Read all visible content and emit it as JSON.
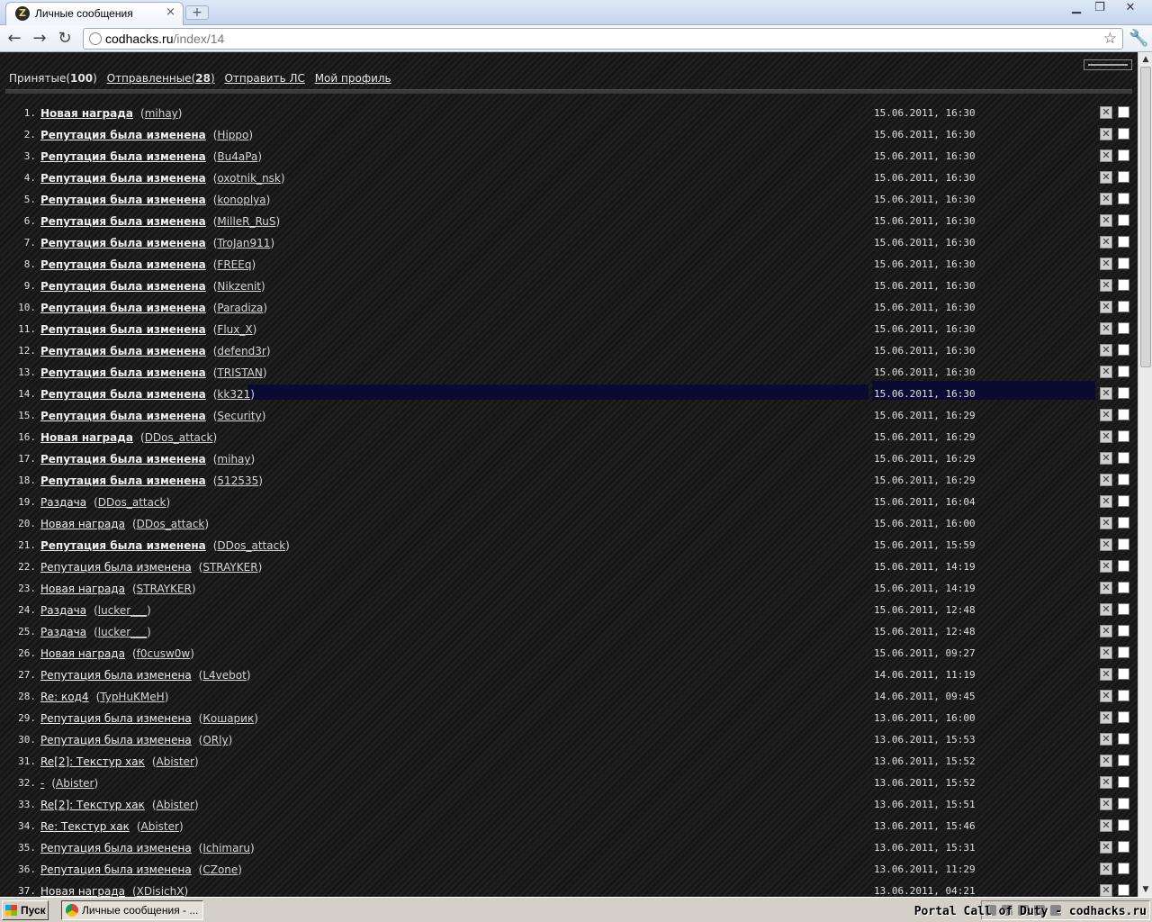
{
  "browser": {
    "tab_title": "Личные сообщения",
    "new_tab": "+",
    "address_host": "codhacks.ru",
    "address_path": "/index/14",
    "window_controls": [
      "minimize-icon",
      "maximize-icon",
      "close-icon"
    ]
  },
  "page": {
    "nav": {
      "inbox_label": "Принятые",
      "inbox_count": "100",
      "sent_label": "Отправленные",
      "sent_count": "28",
      "send_label": "Отправить ЛС",
      "profile_label": "Мой профиль"
    },
    "messages": [
      {
        "n": "1.",
        "title": "Новая награда",
        "user": "mihay",
        "date": "15.06.2011, 16:30",
        "unread": true
      },
      {
        "n": "2.",
        "title": "Репутация была изменена",
        "user": "Hippo",
        "date": "15.06.2011, 16:30",
        "unread": true
      },
      {
        "n": "3.",
        "title": "Репутация была изменена",
        "user": "Bu4aPa",
        "date": "15.06.2011, 16:30",
        "unread": true
      },
      {
        "n": "4.",
        "title": "Репутация была изменена",
        "user": "oxotnik_nsk",
        "date": "15.06.2011, 16:30",
        "unread": true
      },
      {
        "n": "5.",
        "title": "Репутация была изменена",
        "user": "konoplya",
        "date": "15.06.2011, 16:30",
        "unread": true
      },
      {
        "n": "6.",
        "title": "Репутация была изменена",
        "user": "MilleR_RuS",
        "date": "15.06.2011, 16:30",
        "unread": true
      },
      {
        "n": "7.",
        "title": "Репутация была изменена",
        "user": "TroJan911",
        "date": "15.06.2011, 16:30",
        "unread": true
      },
      {
        "n": "8.",
        "title": "Репутация была изменена",
        "user": "FREEq",
        "date": "15.06.2011, 16:30",
        "unread": true
      },
      {
        "n": "9.",
        "title": "Репутация была изменена",
        "user": "Nikzenit",
        "date": "15.06.2011, 16:30",
        "unread": true
      },
      {
        "n": "10.",
        "title": "Репутация была изменена",
        "user": "Paradiza",
        "date": "15.06.2011, 16:30",
        "unread": true
      },
      {
        "n": "11.",
        "title": "Репутация была изменена",
        "user": "Flux_X",
        "date": "15.06.2011, 16:30",
        "unread": true
      },
      {
        "n": "12.",
        "title": "Репутация была изменена",
        "user": "defend3r",
        "date": "15.06.2011, 16:30",
        "unread": true
      },
      {
        "n": "13.",
        "title": "Репутация была изменена",
        "user": "TRISTAN",
        "date": "15.06.2011, 16:30",
        "unread": true
      },
      {
        "n": "14.",
        "title": "Репутация была изменена",
        "user": "kk321",
        "date": "15.06.2011, 16:30",
        "unread": true,
        "highlight": true
      },
      {
        "n": "15.",
        "title": "Репутация была изменена",
        "user": "Security",
        "date": "15.06.2011, 16:29",
        "unread": true
      },
      {
        "n": "16.",
        "title": "Новая награда",
        "user": "DDos_attack",
        "date": "15.06.2011, 16:29",
        "unread": true
      },
      {
        "n": "17.",
        "title": "Репутация была изменена",
        "user": "mihay",
        "date": "15.06.2011, 16:29",
        "unread": true
      },
      {
        "n": "18.",
        "title": "Репутация была изменена",
        "user": "512535",
        "date": "15.06.2011, 16:29",
        "unread": true
      },
      {
        "n": "19.",
        "title": "Раздача",
        "user": "DDos_attack",
        "date": "15.06.2011, 16:04",
        "unread": false
      },
      {
        "n": "20.",
        "title": "Новая награда",
        "user": "DDos_attack",
        "date": "15.06.2011, 16:00",
        "unread": false
      },
      {
        "n": "21.",
        "title": "Репутация была изменена",
        "user": "DDos_attack",
        "date": "15.06.2011, 15:59",
        "unread": true
      },
      {
        "n": "22.",
        "title": "Репутация была изменена",
        "user": "STRAYKER",
        "date": "15.06.2011, 14:19",
        "unread": false
      },
      {
        "n": "23.",
        "title": "Новая награда",
        "user": "STRAYKER",
        "date": "15.06.2011, 14:19",
        "unread": false
      },
      {
        "n": "24.",
        "title": "Раздача",
        "user": "lucker___",
        "date": "15.06.2011, 12:48",
        "unread": false
      },
      {
        "n": "25.",
        "title": "Раздача",
        "user": "lucker___",
        "date": "15.06.2011, 12:48",
        "unread": false
      },
      {
        "n": "26.",
        "title": "Новая награда",
        "user": "f0cusw0w",
        "date": "15.06.2011, 09:27",
        "unread": false
      },
      {
        "n": "27.",
        "title": "Репутация была изменена",
        "user": "L4vebot",
        "date": "14.06.2011, 11:19",
        "unread": false
      },
      {
        "n": "28.",
        "title": "Re: код4",
        "user": "TypHuKMeH",
        "date": "14.06.2011, 09:45",
        "unread": false
      },
      {
        "n": "29.",
        "title": "Репутация была изменена",
        "user": "Кошарик",
        "date": "13.06.2011, 16:00",
        "unread": false
      },
      {
        "n": "30.",
        "title": "Репутация была изменена",
        "user": "ORly",
        "date": "13.06.2011, 15:53",
        "unread": false
      },
      {
        "n": "31.",
        "title": "Re[2]: Текстур хак",
        "user": "Abister",
        "date": "13.06.2011, 15:52",
        "unread": false
      },
      {
        "n": "32.",
        "title": "-",
        "user": "Abister",
        "date": "13.06.2011, 15:52",
        "unread": false
      },
      {
        "n": "33.",
        "title": "Re[2]: Текстур хак",
        "user": "Abister",
        "date": "13.06.2011, 15:51",
        "unread": false
      },
      {
        "n": "34.",
        "title": "Re: Текстур хак",
        "user": "Abister",
        "date": "13.06.2011, 15:46",
        "unread": false
      },
      {
        "n": "35.",
        "title": "Репутация была изменена",
        "user": "Ichimaru",
        "date": "13.06.2011, 15:31",
        "unread": false
      },
      {
        "n": "36.",
        "title": "Репутация была изменена",
        "user": "CZone",
        "date": "13.06.2011, 11:29",
        "unread": false
      },
      {
        "n": "37.",
        "title": "Новая награда",
        "user": "XDisichX",
        "date": "13.06.2011, 04:21",
        "unread": false
      }
    ]
  },
  "taskbar": {
    "start_label": "Пуск",
    "task_label": "Личные сообщения - ...",
    "watermark": "Portal Call of Duty - codhacks.ru"
  },
  "colors": {
    "page_bg": "#1a1a1a",
    "text": "#f0f0f0",
    "highlight": "#0a0a33",
    "chrome": "#c4d4ec"
  }
}
